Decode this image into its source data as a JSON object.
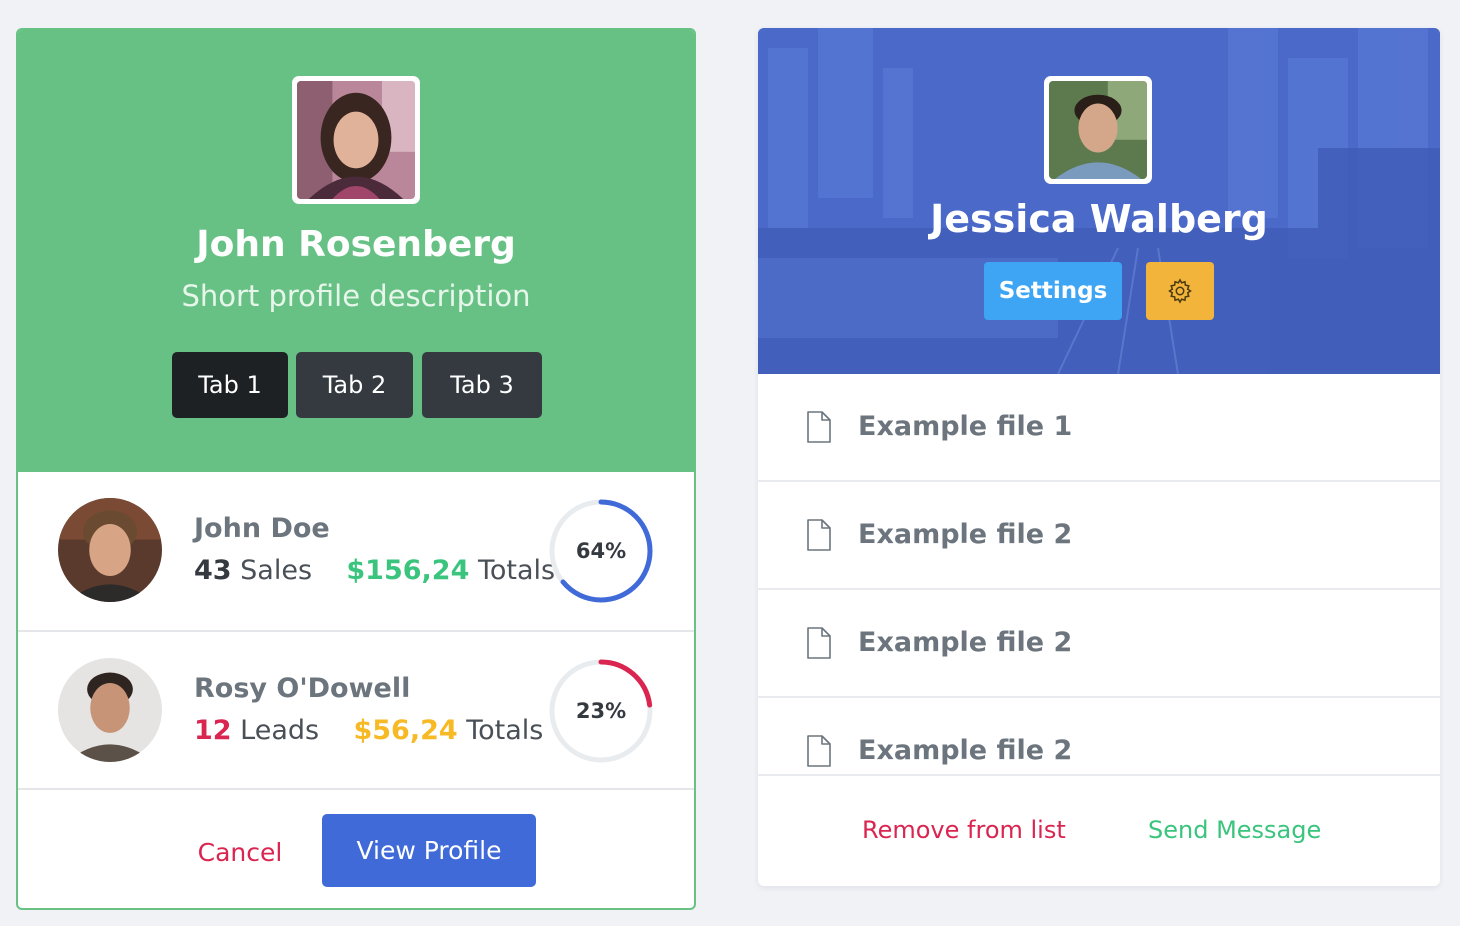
{
  "profile_card": {
    "name": "John Rosenberg",
    "description": "Short profile description",
    "tabs": [
      {
        "label": "Tab 1",
        "active": true
      },
      {
        "label": "Tab 2",
        "active": false
      },
      {
        "label": "Tab 3",
        "active": false
      }
    ],
    "people": [
      {
        "name": "John Doe",
        "count": "43",
        "count_label": "Sales",
        "amount": "$156,24",
        "amount_label": "Totals",
        "percent_text": "64%",
        "progress": 0.64,
        "gauge_color": "#3f6ad8"
      },
      {
        "name": "Rosy O'Dowell",
        "count": "12",
        "count_label": "Leads",
        "amount": "$56,24",
        "amount_label": "Totals",
        "percent_text": "23%",
        "progress": 0.23,
        "gauge_color": "#d92550"
      }
    ],
    "cancel_label": "Cancel",
    "view_profile_label": "View Profile"
  },
  "file_card": {
    "name": "Jessica Walberg",
    "settings_label": "Settings",
    "settings_icon": "gear-icon",
    "files": [
      {
        "label": "Example file 1",
        "icon": "file-icon"
      },
      {
        "label": "Example file 2",
        "icon": "file-icon"
      },
      {
        "label": "Example file 2",
        "icon": "file-icon"
      },
      {
        "label": "Example file 2",
        "icon": "file-icon"
      }
    ],
    "remove_label": "Remove from list",
    "send_label": "Send Message"
  },
  "colors": {
    "green_header": "#68c184",
    "blue_header": "#4a69c9",
    "primary": "#3f6ad8",
    "danger": "#d92550",
    "success": "#3ac47d",
    "warning": "#f7b924"
  }
}
